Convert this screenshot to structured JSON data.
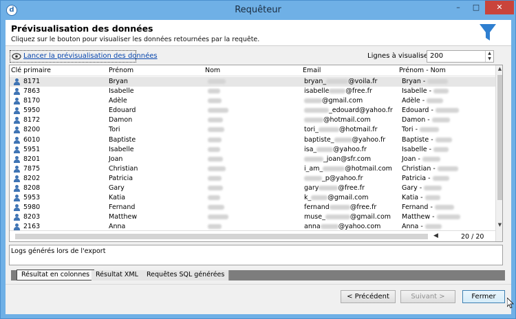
{
  "window": {
    "title": "Requêteur",
    "app_icon": "app-logo-icon"
  },
  "header": {
    "title": "Prévisualisation des données",
    "subtitle": "Cliquez sur le bouton pour visualiser les données retournées par la requête.",
    "icon": "filter-funnel-icon",
    "accent": "#2f7fd0"
  },
  "toolbar": {
    "preview_link": "Lancer la prévisualisation des données",
    "lines_label": "Lignes à visualiser :",
    "lines_value": "200"
  },
  "grid": {
    "columns": [
      "Clé primaire",
      "Prénom",
      "Nom",
      "Email",
      "Prénom - Nom"
    ],
    "rows": [
      {
        "id": "8171",
        "first": "Bryan",
        "email_pre": "bryan_",
        "email_post": "@voila.fr",
        "full": "Bryan -"
      },
      {
        "id": "7863",
        "first": "Isabelle",
        "email_pre": "isabelle",
        "email_post": "@free.fr",
        "full": "Isabelle -"
      },
      {
        "id": "8170",
        "first": "Adèle",
        "email_pre": "",
        "email_post": "@gmail.com",
        "full": "Adèle -"
      },
      {
        "id": "5950",
        "first": "Edouard",
        "email_pre": "",
        "email_post": "_edouard@yahoo.fr",
        "full": "Edouard -"
      },
      {
        "id": "8172",
        "first": "Damon",
        "email_pre": "",
        "email_post": "@hotmail.com",
        "full": "Damon -"
      },
      {
        "id": "8200",
        "first": "Tori",
        "email_pre": "tori_",
        "email_post": "@hotmail.fr",
        "full": "Tori -"
      },
      {
        "id": "6010",
        "first": "Baptiste",
        "email_pre": "baptiste_",
        "email_post": "@yahoo.fr",
        "full": "Baptiste -"
      },
      {
        "id": "5951",
        "first": "Isabelle",
        "email_pre": "isa_",
        "email_post": "@yahoo.fr",
        "full": "Isabelle -"
      },
      {
        "id": "8201",
        "first": "Joan",
        "email_pre": "",
        "email_post": "_joan@sfr.com",
        "full": "Joan -"
      },
      {
        "id": "7875",
        "first": "Christian",
        "email_pre": "i_am_",
        "email_post": "@hotmail.com",
        "full": "Christian -"
      },
      {
        "id": "8202",
        "first": "Patricia",
        "email_pre": "",
        "email_post": "_p@yahoo.fr",
        "full": "Patricia -"
      },
      {
        "id": "8208",
        "first": "Gary",
        "email_pre": "gary",
        "email_post": "@free.fr",
        "full": "Gary -"
      },
      {
        "id": "5953",
        "first": "Katia",
        "email_pre": "k_",
        "email_post": "@gmail.com",
        "full": "Katia -"
      },
      {
        "id": "5980",
        "first": "Fernand",
        "email_pre": "fernand",
        "email_post": "@free.fr",
        "full": "Fernand -"
      },
      {
        "id": "8203",
        "first": "Matthew",
        "email_pre": "muse_",
        "email_post": "@gmail.com",
        "full": "Matthew -"
      },
      {
        "id": "2163",
        "first": "Anna",
        "email_pre": "anna",
        "email_post": "@yahoo.com",
        "full": "Anna -"
      }
    ],
    "record_count": "20 / 20"
  },
  "logs": {
    "label": "Logs générés lors de l'export"
  },
  "tabs": [
    {
      "label": "Résultat en colonnes",
      "active": true
    },
    {
      "label": "Résultat XML",
      "active": false
    },
    {
      "label": "Requêtes SQL générées",
      "active": false
    }
  ],
  "buttons": {
    "previous": "< Précédent",
    "next": "Suivant >",
    "close": "Fermer"
  },
  "titlebar_buttons": {
    "minimize": "–",
    "maximize": "□",
    "close": "✕"
  },
  "scroll": {
    "up": "▲",
    "down": "▼",
    "left": "◀"
  },
  "spinner": {
    "up": "▲",
    "down": "▼"
  }
}
